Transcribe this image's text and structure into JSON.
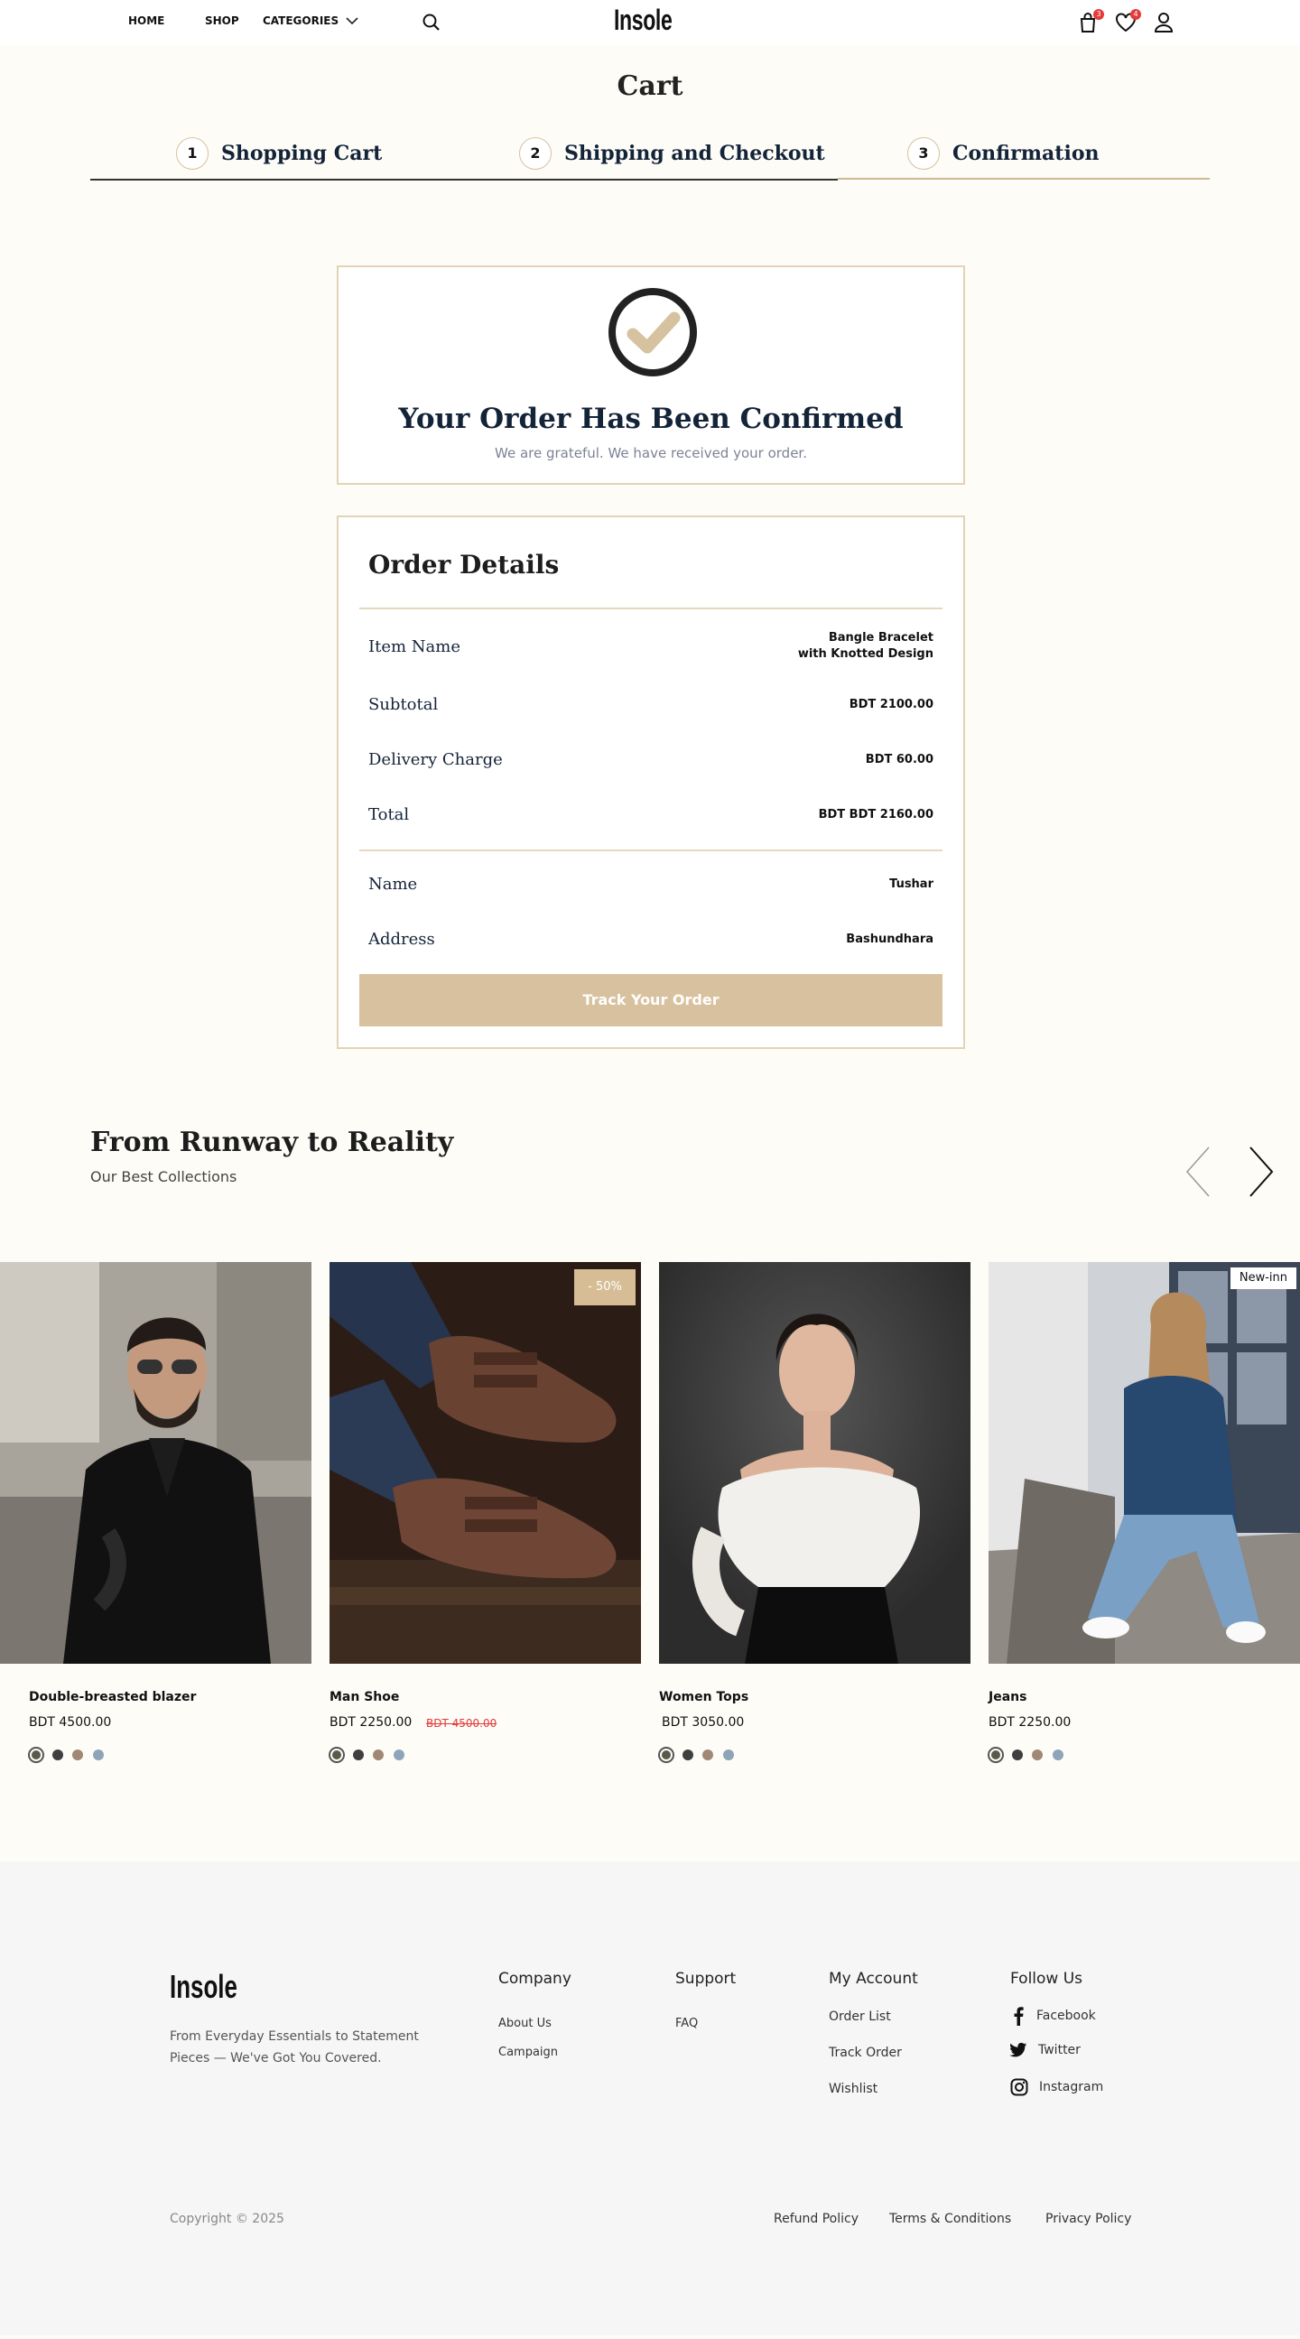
{
  "header": {
    "nav": {
      "home": "HOME",
      "shop": "SHOP",
      "categories": "CATEGORIES"
    },
    "logo": "Insole",
    "cart_count": "3",
    "wishlist_count": "4"
  },
  "cart": {
    "title": "Cart",
    "steps": [
      {
        "num": "1",
        "label": "Shopping Cart"
      },
      {
        "num": "2",
        "label": "Shipping and Checkout"
      },
      {
        "num": "3",
        "label": "Confirmation"
      }
    ]
  },
  "confirmation": {
    "title": "Your Order Has Been Confirmed",
    "subtitle": "We are grateful. We have received your order."
  },
  "order": {
    "title": "Order Details",
    "item_label": "Item Name",
    "item_value_line1": "Bangle Bracelet",
    "item_value_line2": "with Knotted Design",
    "subtotal_label": "Subtotal",
    "subtotal_value": "BDT 2100.00",
    "delivery_label": "Delivery Charge",
    "delivery_value": "BDT 60.00",
    "total_label": "Total",
    "total_value": "BDT BDT 2160.00",
    "name_label": "Name",
    "name_value": "Tushar",
    "address_label": "Address",
    "address_value": "Bashundhara",
    "track_button": "Track Your Order"
  },
  "collection": {
    "title": "From Runway to Reality",
    "subtitle": "Our Best Collections",
    "products": [
      {
        "name": "Double-breasted blazer",
        "price": "BDT 4500.00",
        "old_price": "",
        "tag": ""
      },
      {
        "name": "Man Shoe",
        "price": "BDT 2250.00",
        "old_price": "BDT 4500.00",
        "tag": "- 50%"
      },
      {
        "name": "Women Tops",
        "price": "BDT 3050.00",
        "old_price": "",
        "tag": ""
      },
      {
        "name": "Jeans",
        "price": "BDT 2250.00",
        "old_price": "",
        "tag": "New-inn"
      }
    ],
    "swatch_colors": [
      "#5a5a4a",
      "#3f3f3f",
      "#a08874",
      "#8ea4b8"
    ]
  },
  "footer": {
    "logo": "Insole",
    "tagline": "From Everyday Essentials to Statement Pieces — We've Got You Covered.",
    "company": {
      "heading": "Company",
      "links": [
        "About Us",
        "Campaign"
      ]
    },
    "support": {
      "heading": "Support",
      "links": [
        "FAQ"
      ]
    },
    "account": {
      "heading": "My Account",
      "links": [
        "Order List",
        "Track Order",
        "Wishlist"
      ]
    },
    "follow": {
      "heading": "Follow Us",
      "links": [
        "Facebook",
        "Twitter",
        "Instagram"
      ]
    },
    "copyright": "Copyright © 2025",
    "policies": [
      "Refund Policy",
      "Terms & Conditions",
      "Privacy Policy"
    ]
  },
  "colors": {
    "accent": "#d8c19e",
    "background": "#fdfcf7",
    "navy": "#132338",
    "badge": "#e43a3a",
    "sale": "#e23b3b"
  }
}
